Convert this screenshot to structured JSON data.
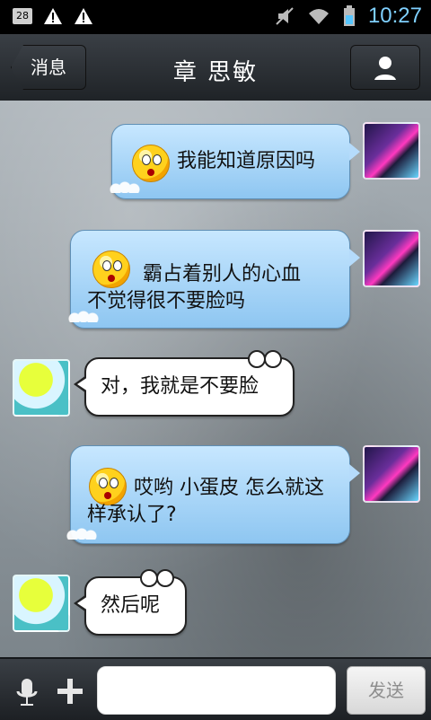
{
  "status_bar": {
    "badge": "28",
    "time": "10:27"
  },
  "header": {
    "back_label": "消息",
    "title": "章  思敏"
  },
  "messages": [
    {
      "from": "me",
      "text": "我能知道原因吗",
      "emoji": "surprised-emoji"
    },
    {
      "from": "me",
      "text": "霸占着别人的心血\n不觉得很不要脸吗",
      "emoji": "surprised-emoji"
    },
    {
      "from": "them",
      "text": "对，我就是不要脸"
    },
    {
      "from": "me",
      "text": "哎哟 小蛋皮 怎么就这\n样承认了?",
      "emoji": "surprised-emoji"
    },
    {
      "from": "them",
      "text": "然后呢"
    }
  ],
  "input_bar": {
    "send_label": "发送"
  },
  "icons": [
    "microphone-icon",
    "plus-icon",
    "person-icon",
    "mute-icon",
    "wifi-icon",
    "battery-icon",
    "warning-icon"
  ]
}
